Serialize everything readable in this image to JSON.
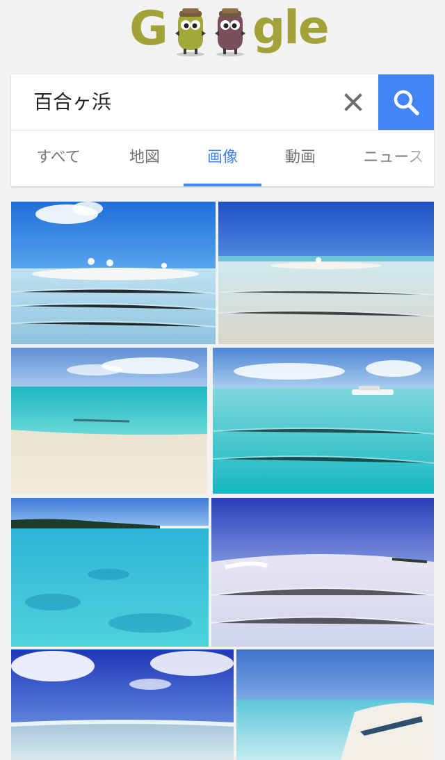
{
  "logo": {
    "first_letter": "G",
    "last_letters": "gle",
    "color": "#a2a238",
    "mascots": [
      "olive-mascot-icon",
      "purple-mascot-icon"
    ]
  },
  "search": {
    "query": "百合ヶ浜",
    "clear_icon": "close-icon",
    "button_icon": "search-icon",
    "button_color": "#4285f4"
  },
  "tabs": [
    {
      "label": "すべて",
      "active": false
    },
    {
      "label": "地図",
      "active": false
    },
    {
      "label": "画像",
      "active": true
    },
    {
      "label": "動画",
      "active": false
    },
    {
      "label": "ニュース",
      "active": false
    }
  ],
  "results": {
    "count_visible": 8,
    "items": [
      {
        "subject": "beach sandbar with umbrellas"
      },
      {
        "subject": "shallow clear water sandbar"
      },
      {
        "subject": "turquoise sea with swimmer"
      },
      {
        "subject": "turquoise sea with boat"
      },
      {
        "subject": "shoreline with trees"
      },
      {
        "subject": "wide-angle sandbar"
      },
      {
        "subject": "clouds over sandbar"
      },
      {
        "subject": "kayak on white sand"
      }
    ]
  }
}
